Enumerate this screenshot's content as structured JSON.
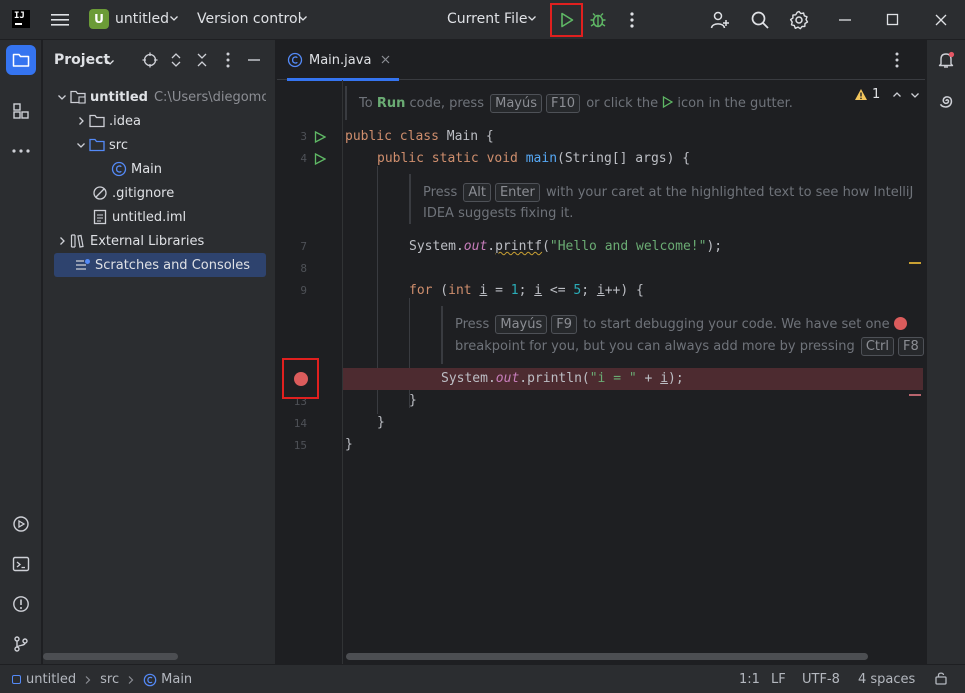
{
  "titlebar": {
    "logo": "IJ",
    "project_badge": "U",
    "project_name": "untitled",
    "vcs_label": "Version control",
    "run_config": "Current File"
  },
  "project_panel": {
    "title": "Project",
    "tree": [
      {
        "label": "untitled",
        "path": "C:\\Users\\diegomoiss"
      },
      {
        "label": ".idea"
      },
      {
        "label": "src"
      },
      {
        "label": "Main"
      },
      {
        "label": ".gitignore"
      },
      {
        "label": "untitled.iml"
      },
      {
        "label": "External Libraries"
      },
      {
        "label": "Scratches and Consoles"
      }
    ]
  },
  "editor": {
    "tab_label": "Main.java",
    "warning_count": "1",
    "line_numbers": [
      "3",
      "4",
      "7",
      "8",
      "9",
      "13",
      "14",
      "15"
    ],
    "hint_top": {
      "pre": "To",
      "run": "Run",
      "mid": "code, press",
      "key1": "Mayús",
      "key2": "F10",
      "post": "or click the",
      "post2": "icon in the gutter."
    },
    "hint_alt": {
      "pre": "Press",
      "key1": "Alt",
      "key2": "Enter",
      "line1": "with your caret at the highlighted text to see how IntelliJ",
      "line2": "IDEA suggests fixing it."
    },
    "hint_debug": {
      "pre": "Press",
      "key1": "Mayús",
      "key2": "F9",
      "line1": "to start debugging your code. We have set one",
      "line2": "breakpoint for you, but you can always add more by pressing",
      "key3": "Ctrl",
      "key4": "F8",
      "end": "."
    }
  },
  "statusbar": {
    "crumb1": "untitled",
    "crumb2": "src",
    "crumb3": "Main",
    "position": "1:1",
    "line_sep": "LF",
    "encoding": "UTF-8",
    "indent": "4 spaces"
  },
  "colors": {
    "accent": "#3574f0",
    "run_green": "#5fb865",
    "breakpoint": "#db5c5c",
    "highlight_box": "#e0201f"
  }
}
